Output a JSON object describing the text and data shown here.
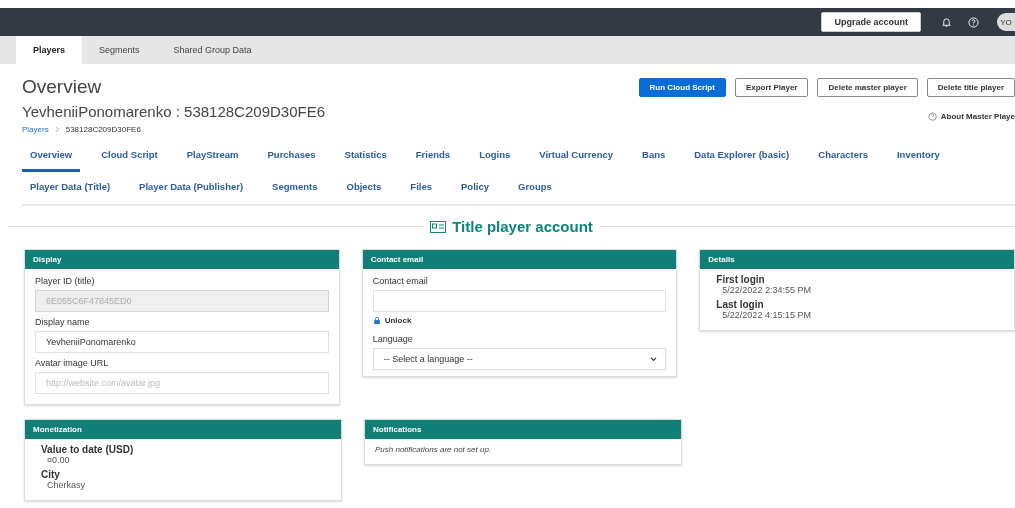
{
  "top_bar": {
    "upgrade_button": "Upgrade account",
    "avatar": "YO"
  },
  "nav_tabs": [
    {
      "label": "Players",
      "selected": true
    },
    {
      "label": "Segments",
      "selected": false
    },
    {
      "label": "Shared Group Data",
      "selected": false
    }
  ],
  "header": {
    "title": "Overview",
    "player_heading": "YevheniiPonomarenko : 538128C209D30FE6",
    "breadcrumb": [
      {
        "label": "Players",
        "kind": "link"
      },
      {
        "label": "538128C209D30FE6",
        "kind": "current"
      }
    ],
    "buttons": [
      {
        "label": "Run Cloud Script",
        "kind": "primary"
      },
      {
        "label": "Export Player",
        "kind": "secondary"
      },
      {
        "label": "Delete master player",
        "kind": "secondary"
      },
      {
        "label": "Delete title player",
        "kind": "secondary"
      }
    ],
    "about_link": "About Master Playe"
  },
  "tab_rows": [
    [
      {
        "label": "Overview",
        "selected": true
      },
      {
        "label": "Cloud Script",
        "selected": false
      },
      {
        "label": "PlayStream",
        "selected": false
      },
      {
        "label": "Purchases",
        "selected": false
      },
      {
        "label": "Statistics",
        "selected": false
      },
      {
        "label": "Friends",
        "selected": false
      },
      {
        "label": "Logins",
        "selected": false
      },
      {
        "label": "Virtual Currency",
        "selected": false
      },
      {
        "label": "Bans",
        "selected": false
      },
      {
        "label": "Data Explorer (basic)",
        "selected": false
      },
      {
        "label": "Characters",
        "selected": false
      },
      {
        "label": "Inventory",
        "selected": false
      }
    ],
    [
      {
        "label": "Player Data (Title)",
        "selected": false
      },
      {
        "label": "Player Data (Publisher)",
        "selected": false
      },
      {
        "label": "Segments",
        "selected": false
      },
      {
        "label": "Objects",
        "selected": false
      },
      {
        "label": "Files",
        "selected": false
      },
      {
        "label": "Policy",
        "selected": false
      },
      {
        "label": "Groups",
        "selected": false
      }
    ]
  ],
  "section_title": "Title player account",
  "card_rows": [
    [
      {
        "title": "Display",
        "kind": "form",
        "fields": [
          {
            "kind": "input",
            "label": "Player ID (title)",
            "value": "6E055C6F47845ED0",
            "disabled": true
          },
          {
            "kind": "input",
            "label": "Display name",
            "value": "YevheniiPonomarenko",
            "disabled": false
          },
          {
            "kind": "input",
            "label": "Avatar image URL",
            "placeholder": "http://website.com/avatar.jpg",
            "disabled": false
          }
        ]
      },
      {
        "title": "Contact email",
        "kind": "form",
        "fields": [
          {
            "kind": "input",
            "label": "Contact email",
            "disabled": false
          },
          {
            "kind": "unlock",
            "label": "Unlock"
          },
          {
            "kind": "select",
            "label": "Language",
            "value": "-- Select a language --"
          }
        ]
      },
      {
        "title": "Details",
        "kind": "info",
        "items": [
          {
            "label": "First login",
            "value": "5/22/2022 2:34:55 PM"
          },
          {
            "label": "Last login",
            "value": "5/22/2022 4:15:15 PM"
          }
        ]
      }
    ],
    [
      {
        "title": "Monetization",
        "kind": "info",
        "items": [
          {
            "label": "Value to date (USD)",
            "value": "¤0.00"
          },
          {
            "label": "City",
            "value": "Cherkasy"
          }
        ]
      },
      {
        "title": "Notifications",
        "kind": "note",
        "text": "Push notifications are not set up."
      }
    ]
  ]
}
